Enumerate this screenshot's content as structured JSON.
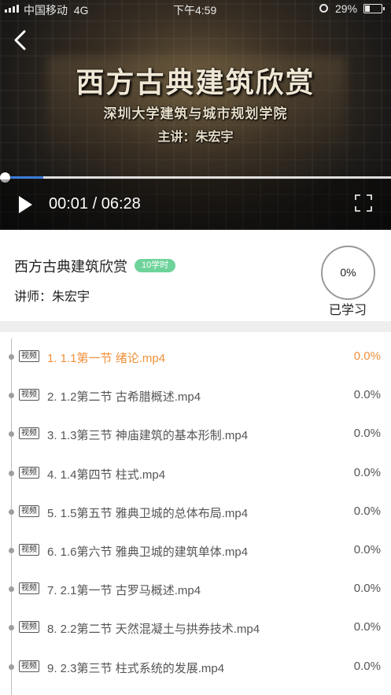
{
  "status_bar": {
    "carrier": "中国移动",
    "network": "4G",
    "time": "下午4:59",
    "battery": "29%"
  },
  "video": {
    "title_text": "西方古典建筑欣赏",
    "subtitle_text": "深圳大学建筑与城市规划学院",
    "lecturer_text": "主讲：朱宏宇",
    "current_time": "00:01",
    "duration": "06:28",
    "time_display": "00:01 / 06:28",
    "progress_fraction": 0.0026,
    "buffered_fraction": 0.11
  },
  "course": {
    "title": "西方古典建筑欣赏",
    "hours_badge": "10学时",
    "teacher": "讲师：朱宏宇",
    "study_percent": "0%",
    "study_label": "已学习"
  },
  "lessons": [
    {
      "tag": "视频",
      "title": "1. 1.1第一节 绪论.mp4",
      "progress": "0.0%",
      "active": true
    },
    {
      "tag": "视频",
      "title": "2. 1.2第二节 古希腊概述.mp4",
      "progress": "0.0%",
      "active": false
    },
    {
      "tag": "视频",
      "title": "3. 1.3第三节 神庙建筑的基本形制.mp4",
      "progress": "0.0%",
      "active": false
    },
    {
      "tag": "视频",
      "title": "4. 1.4第四节 柱式.mp4",
      "progress": "0.0%",
      "active": false
    },
    {
      "tag": "视频",
      "title": "5. 1.5第五节 雅典卫城的总体布局.mp4",
      "progress": "0.0%",
      "active": false
    },
    {
      "tag": "视频",
      "title": "6. 1.6第六节 雅典卫城的建筑单体.mp4",
      "progress": "0.0%",
      "active": false
    },
    {
      "tag": "视频",
      "title": "7. 2.1第一节 古罗马概述.mp4",
      "progress": "0.0%",
      "active": false
    },
    {
      "tag": "视频",
      "title": "8. 2.2第二节 天然混凝土与拱券技术.mp4",
      "progress": "0.0%",
      "active": false
    },
    {
      "tag": "视频",
      "title": "9. 2.3第三节 柱式系统的发展.mp4",
      "progress": "0.0%",
      "active": false
    }
  ],
  "colors": {
    "accent_active": "#f0903a",
    "badge_green": "#6dd39a",
    "progress_blue": "#3b7ddb"
  }
}
